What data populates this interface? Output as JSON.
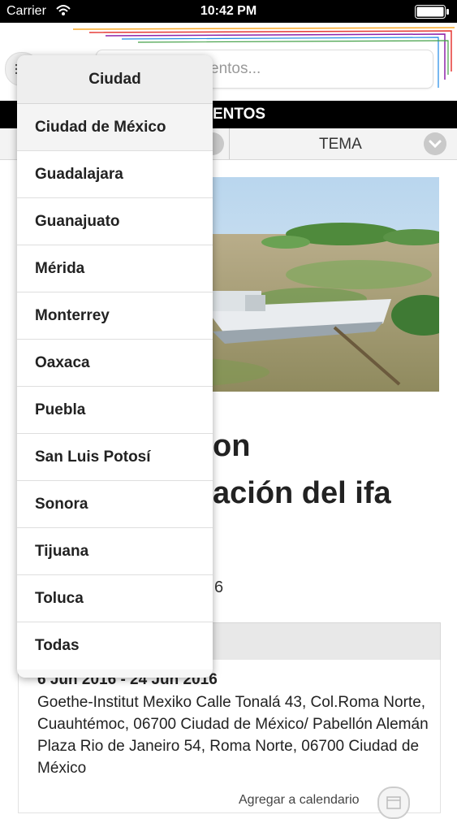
{
  "status_bar": {
    "carrier": "Carrier",
    "time": "10:42 PM"
  },
  "search": {
    "placeholder_visible": "entos..."
  },
  "section_title": "ENTOS",
  "filters": {
    "tema_label": "TEMA"
  },
  "event": {
    "title_line1": "on",
    "title_line2": "ación del ifa",
    "date_short_fragment": "6",
    "date_range": "6 Jun 2016 - 24 Jun 2016",
    "address": "Goethe-Institut Mexiko Calle Tonalá 43, Col.Roma Norte, Cuauhtémoc, 06700 Ciudad de México/ Pabellón Alemán Plaza Rio de Janeiro 54, Roma Norte, 06700 Ciudad de México",
    "add_to_calendar": "Agregar a calendario"
  },
  "city_dropdown": {
    "title": "Ciudad",
    "items": [
      {
        "label": "Ciudad de México"
      },
      {
        "label": "Guadalajara"
      },
      {
        "label": "Guanajuato"
      },
      {
        "label": "Mérida"
      },
      {
        "label": "Monterrey"
      },
      {
        "label": "Oaxaca"
      },
      {
        "label": "Puebla"
      },
      {
        "label": "San Luis Potosí"
      },
      {
        "label": "Sonora"
      },
      {
        "label": "Tijuana"
      },
      {
        "label": "Toluca"
      },
      {
        "label": "Todas"
      }
    ],
    "selected": "Ciudad de México"
  },
  "colors": {
    "title_bar": "#000000",
    "filter_bar": "#f3f3f3",
    "deco_lines": [
      "#e53935",
      "#f9a825",
      "#8e24aa",
      "#1e88e5",
      "#43a047"
    ]
  },
  "icons": [
    "wifi-icon",
    "battery-icon",
    "menu-icon",
    "chevron-down-icon",
    "calendar-icon"
  ]
}
